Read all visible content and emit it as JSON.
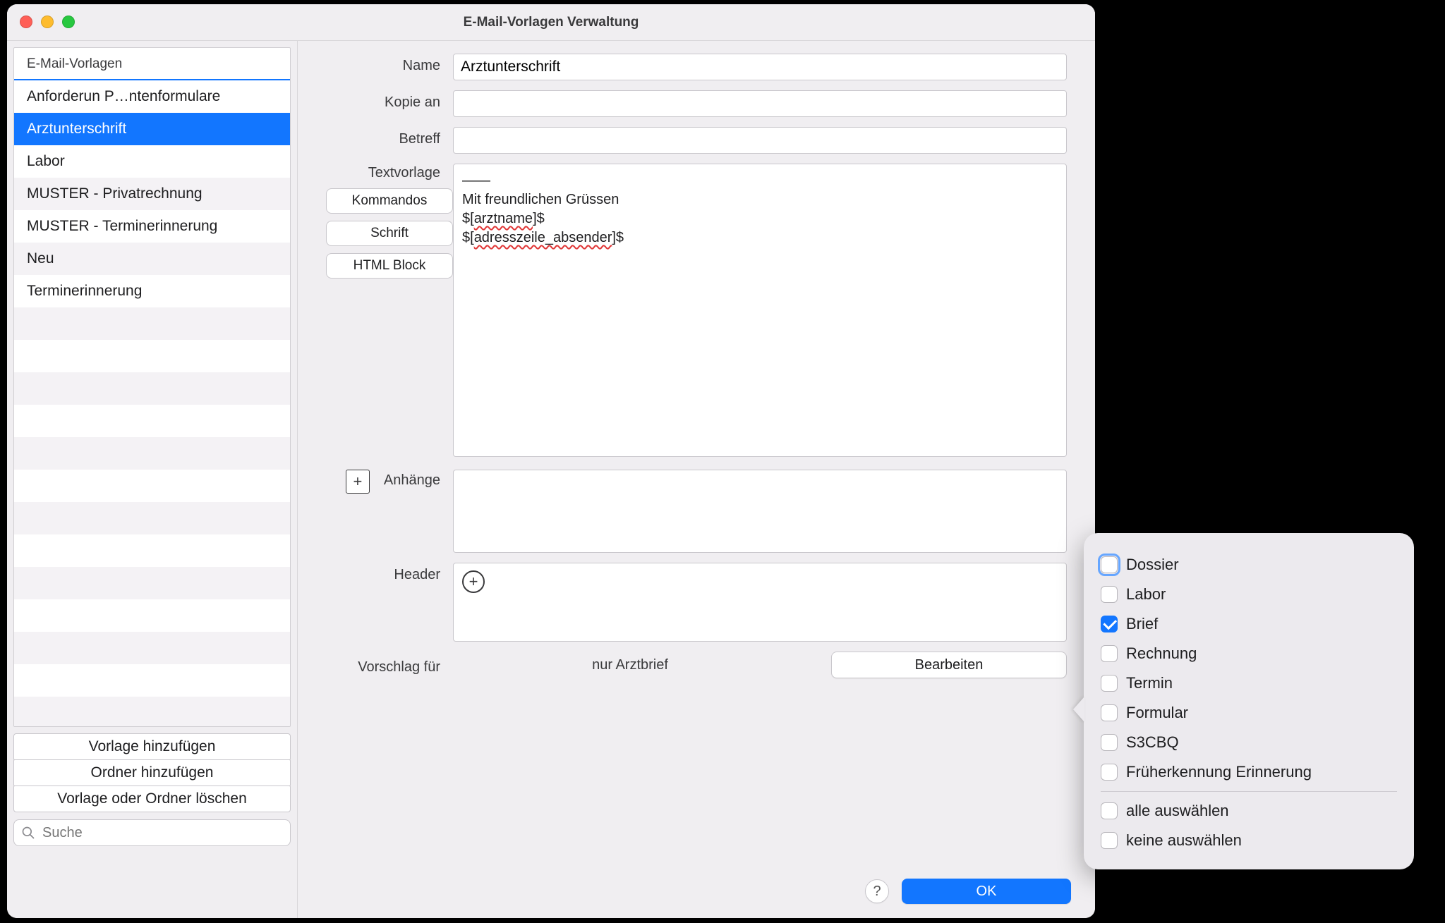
{
  "window": {
    "title": "E-Mail-Vorlagen Verwaltung"
  },
  "sidebar": {
    "header": "E-Mail-Vorlagen",
    "items": [
      {
        "label": "Anforderun P…ntenformulare",
        "selected": false
      },
      {
        "label": "Arztunterschrift",
        "selected": true
      },
      {
        "label": "Labor",
        "selected": false
      },
      {
        "label": "MUSTER - Privatrechnung",
        "selected": false
      },
      {
        "label": "MUSTER - Terminerinnerung",
        "selected": false
      },
      {
        "label": "Neu",
        "selected": false
      },
      {
        "label": "Terminerinnerung",
        "selected": false
      }
    ],
    "buttons": {
      "add_template": "Vorlage hinzufügen",
      "add_folder": "Ordner hinzufügen",
      "delete": "Vorlage oder Ordner löschen"
    },
    "search_placeholder": "Suche"
  },
  "form": {
    "labels": {
      "name": "Name",
      "copy_to": "Kopie an",
      "subject": "Betreff",
      "text_template": "Textvorlage",
      "attachments": "Anhänge",
      "header": "Header",
      "suggest_for": "Vorschlag für"
    },
    "name_value": "Arztunterschrift",
    "copy_to_value": "",
    "subject_value": "",
    "text_template_value_line1": "——",
    "text_template_value_line2": "Mit freundlichen Grüssen",
    "text_template_value_line3a": "$[",
    "text_template_value_line3b": "arztname",
    "text_template_value_line3c": "]$",
    "text_template_value_line4a": "$[",
    "text_template_value_line4b": "adresszeile_absender",
    "text_template_value_line4c": "]$",
    "side_buttons": {
      "commands": "Kommandos",
      "font": "Schrift",
      "html_block": "HTML Block"
    },
    "suggest_value": "nur Arztbrief",
    "edit_button": "Bearbeiten"
  },
  "footer": {
    "help": "?",
    "ok": "OK"
  },
  "popover": {
    "options": [
      {
        "label": "Dossier",
        "checked": false,
        "focused": true
      },
      {
        "label": "Labor",
        "checked": false
      },
      {
        "label": "Brief",
        "checked": true
      },
      {
        "label": "Rechnung",
        "checked": false
      },
      {
        "label": "Termin",
        "checked": false
      },
      {
        "label": "Formular",
        "checked": false
      },
      {
        "label": "S3CBQ",
        "checked": false
      },
      {
        "label": "Früherkennung Erinnerung",
        "checked": false
      }
    ],
    "select_all": "alle auswählen",
    "select_none": "keine auswählen"
  }
}
